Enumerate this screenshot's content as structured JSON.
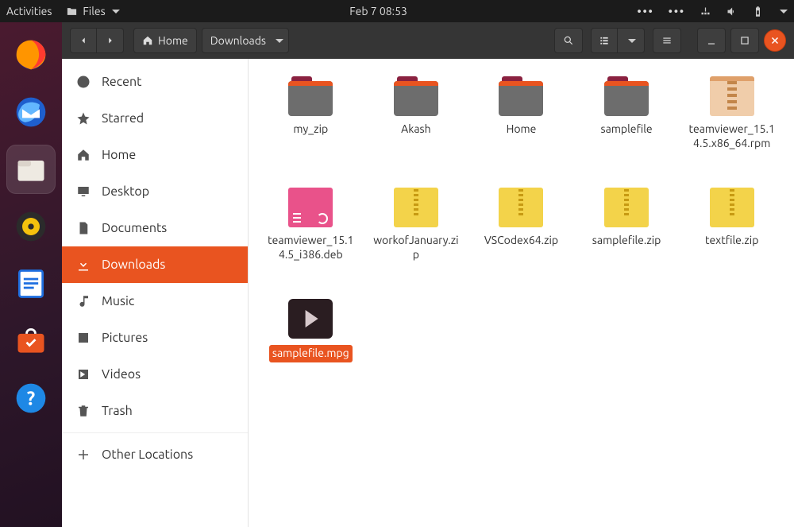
{
  "topbar": {
    "activities": "Activities",
    "app_label": "Files",
    "datetime": "Feb 7  08:53"
  },
  "dock": [
    {
      "name": "firefox"
    },
    {
      "name": "thunderbird"
    },
    {
      "name": "files",
      "active": true
    },
    {
      "name": "rhythmbox"
    },
    {
      "name": "libreoffice-writer"
    },
    {
      "name": "ubuntu-software"
    },
    {
      "name": "help"
    }
  ],
  "path": {
    "crumbs": [
      "Home",
      "Downloads"
    ]
  },
  "sidebar": {
    "items": [
      {
        "icon": "clock",
        "label": "Recent"
      },
      {
        "icon": "star",
        "label": "Starred"
      },
      {
        "icon": "home",
        "label": "Home"
      },
      {
        "icon": "desktop",
        "label": "Desktop"
      },
      {
        "icon": "doc",
        "label": "Documents"
      },
      {
        "icon": "download",
        "label": "Downloads",
        "active": true
      },
      {
        "icon": "music",
        "label": "Music"
      },
      {
        "icon": "pictures",
        "label": "Pictures"
      },
      {
        "icon": "videos",
        "label": "Videos"
      },
      {
        "icon": "trash",
        "label": "Trash"
      }
    ],
    "other_locations": "Other Locations"
  },
  "files": [
    {
      "type": "folder",
      "label": "my_zip"
    },
    {
      "type": "folder",
      "label": "Akash"
    },
    {
      "type": "folder",
      "label": "Home"
    },
    {
      "type": "folder",
      "label": "samplefile"
    },
    {
      "type": "rpm",
      "label": "teamviewer_15.14.5.x86_64.rpm"
    },
    {
      "type": "deb",
      "label": "teamviewer_15.14.5_i386.deb"
    },
    {
      "type": "zip",
      "label": "workofJanuary.zip"
    },
    {
      "type": "zip",
      "label": "VSCodex64.zip"
    },
    {
      "type": "zip",
      "label": "samplefile.zip"
    },
    {
      "type": "zip",
      "label": "textfile.zip"
    },
    {
      "type": "video",
      "label": "samplefile.mpg",
      "selected": true
    }
  ]
}
